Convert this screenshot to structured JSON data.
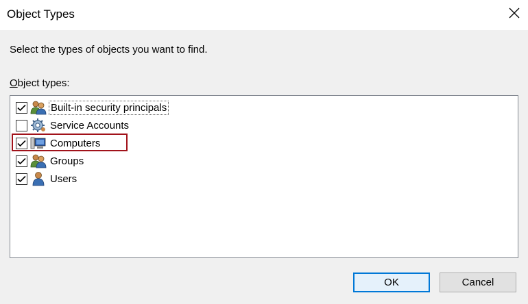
{
  "window": {
    "title": "Object Types",
    "close_icon": "close-icon"
  },
  "instruction": "Select the types of objects you want to find.",
  "group_label_underline": "O",
  "group_label_rest": "bject types:",
  "object_types": [
    {
      "label": "Built-in security principals",
      "checked": true,
      "icon": "security-principals-icon"
    },
    {
      "label": "Service Accounts",
      "checked": false,
      "icon": "service-accounts-icon"
    },
    {
      "label": "Computers",
      "checked": true,
      "icon": "computer-icon"
    },
    {
      "label": "Groups",
      "checked": true,
      "icon": "groups-icon"
    },
    {
      "label": "Users",
      "checked": true,
      "icon": "user-icon"
    }
  ],
  "buttons": {
    "ok": "OK",
    "cancel": "Cancel"
  },
  "colors": {
    "highlight": "#a1121a",
    "primary_border": "#0078d7"
  }
}
